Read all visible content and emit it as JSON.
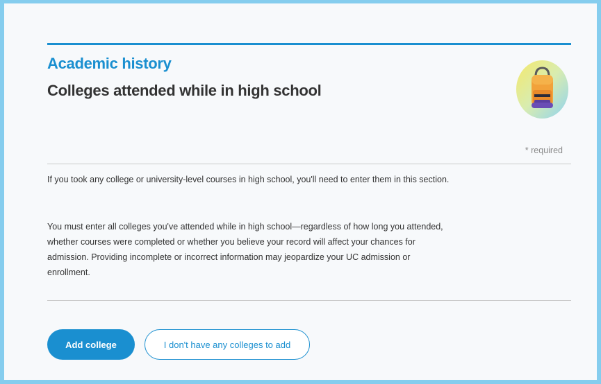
{
  "header": {
    "section_label": "Academic history",
    "title": "Colleges attended while in high school",
    "icon": "backpack-icon"
  },
  "required_note": "* required",
  "body": {
    "paragraph_1": "If you took any college or university-level courses in high school, you'll need to enter them in this section.",
    "paragraph_2": "You must enter all colleges you've attended while in high school—regardless of how long you attended, whether courses were completed or whether you believe your record will affect your chances for admission. Providing incomplete or incorrect information may jeopardize your UC admission or enrollment."
  },
  "actions": {
    "add_label": "Add college",
    "none_label": "I don't have any colleges to add"
  },
  "colors": {
    "accent": "#1a8fd0",
    "frame_border": "#85cdee",
    "text": "#333333"
  }
}
